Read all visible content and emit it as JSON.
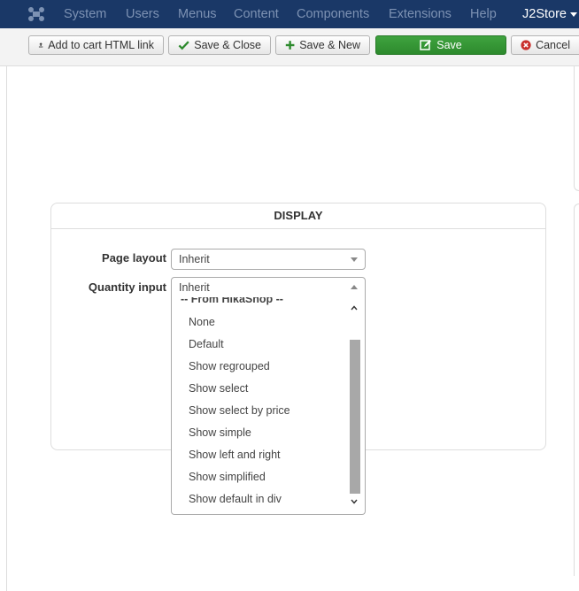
{
  "navbar": {
    "items": [
      "System",
      "Users",
      "Menus",
      "Content",
      "Components",
      "Extensions",
      "Help"
    ],
    "brand": "J2Store"
  },
  "toolbar": {
    "add_to_cart_label": "Add to cart HTML link",
    "save_close_label": "Save & Close",
    "save_new_label": "Save & New",
    "save_label": "Save",
    "cancel_label": "Cancel"
  },
  "display": {
    "heading": "DISPLAY",
    "page_layout_label": "Page layout",
    "page_layout_value": "Inherit",
    "quantity_input_label": "Quantity input",
    "quantity_input_value": "Inherit"
  },
  "dropdown": {
    "group_label": "-- From HikaShop --",
    "options": [
      "None",
      "Default",
      "Show regrouped",
      "Show select",
      "Show select by price",
      "Show simple",
      "Show left and right",
      "Show simplified",
      "Show default in div"
    ]
  },
  "colors": {
    "navbar_bg": "#1a3867",
    "nav_text": "#7d92b3",
    "save_green": "#2d8a2d",
    "cancel_red": "#c9302c"
  }
}
